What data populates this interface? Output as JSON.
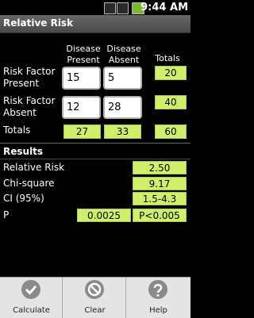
{
  "status_bar": {
    "time": "9:44 AM",
    "icons": [
      "3g-icon",
      "signal-icon",
      "battery-icon"
    ]
  },
  "app": {
    "title": "Relative Risk"
  },
  "table": {
    "col_headers": {
      "disease_present": "Disease Present",
      "disease_absent": "Disease Absent",
      "totals": "Totals"
    },
    "rows": {
      "risk_present": {
        "label": "Risk Factor Present",
        "disease_present": "15",
        "disease_absent": "5",
        "total": "20"
      },
      "risk_absent": {
        "label": "Risk Factor Absent",
        "disease_present": "12",
        "disease_absent": "28",
        "total": "40"
      },
      "totals": {
        "label": "Totals",
        "disease_present": "27",
        "disease_absent": "33",
        "total": "60"
      }
    }
  },
  "results": {
    "heading": "Results",
    "relative_risk": {
      "label": "Relative Risk",
      "value": "2.50"
    },
    "chi_square": {
      "label": "Chi-square",
      "value": "9.17"
    },
    "ci": {
      "label": "CI (95%)",
      "value": "1.5-4.3"
    },
    "p": {
      "label": "P",
      "value": "0.0025",
      "value2": "P<0.005"
    }
  },
  "menu": {
    "calculate": "Calculate",
    "clear": "Clear",
    "help": "Help"
  },
  "colors": {
    "accent": "#d0f06c",
    "background": "#000000"
  }
}
